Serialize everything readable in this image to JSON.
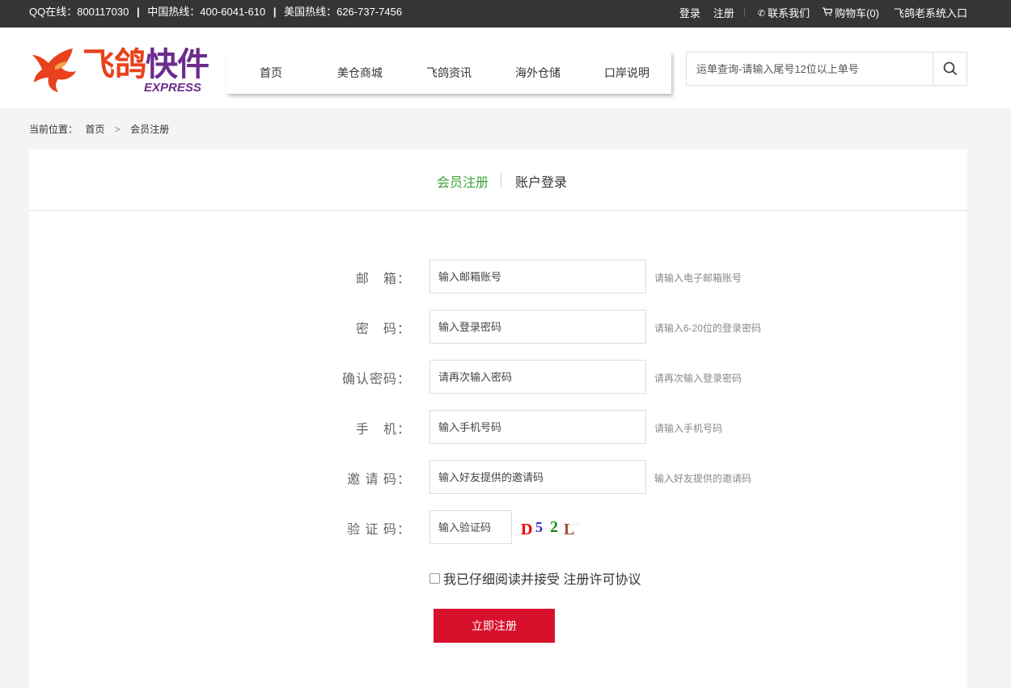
{
  "topbar": {
    "qq": "QQ在线：800117030",
    "china_hotline": "中国热线：400-6041-610",
    "us_hotline": "美国热线：626-737-7456",
    "separator": "|",
    "login": "登录",
    "register": "注册",
    "contact": "联系我们",
    "cart": "购物车(0)",
    "old_system": "飞鸽老系统入口"
  },
  "logo": {
    "text_part1": "飞鸽",
    "text_part2": "快件",
    "sub": "EXPRESS"
  },
  "nav": {
    "items": [
      "首页",
      "美仓商城",
      "飞鸽资讯",
      "海外仓储",
      "口岸说明"
    ]
  },
  "search": {
    "placeholder": "运单查询-请输入尾号12位以上单号"
  },
  "breadcrumb": {
    "label": "当前位置：",
    "home": "首页",
    "gt": ">",
    "current": "会员注册"
  },
  "tabs": {
    "active": "会员注册",
    "other": "账户登录"
  },
  "form": {
    "email": {
      "label": "邮　箱：",
      "placeholder": "输入邮箱账号",
      "hint": "请输入电子邮箱账号"
    },
    "password": {
      "label": "密　码：",
      "placeholder": "输入登录密码",
      "hint": "请输入6-20位的登录密码"
    },
    "confirm": {
      "label": "确认密码：",
      "placeholder": "请再次输入密码",
      "hint": "请再次输入登录密码"
    },
    "phone": {
      "label": "手　机：",
      "placeholder": "输入手机号码",
      "hint": "请输入手机号码"
    },
    "invite": {
      "label": "邀 请 码：",
      "placeholder": "输入好友提供的邀请码",
      "hint": "输入好友提供的邀请码"
    },
    "captcha": {
      "label": "验 证 码：",
      "placeholder": "输入验证码",
      "chars": [
        "D",
        "5",
        "2",
        "L"
      ]
    },
    "agree": "我已仔细阅读并接受 注册许可协议",
    "submit": "立即注册"
  },
  "colors": {
    "topbar": "#353535",
    "accent_green": "#3fa535",
    "submit_red": "#d7102c",
    "logo_orange": "#e8411b",
    "logo_purple": "#6b2c8c"
  }
}
